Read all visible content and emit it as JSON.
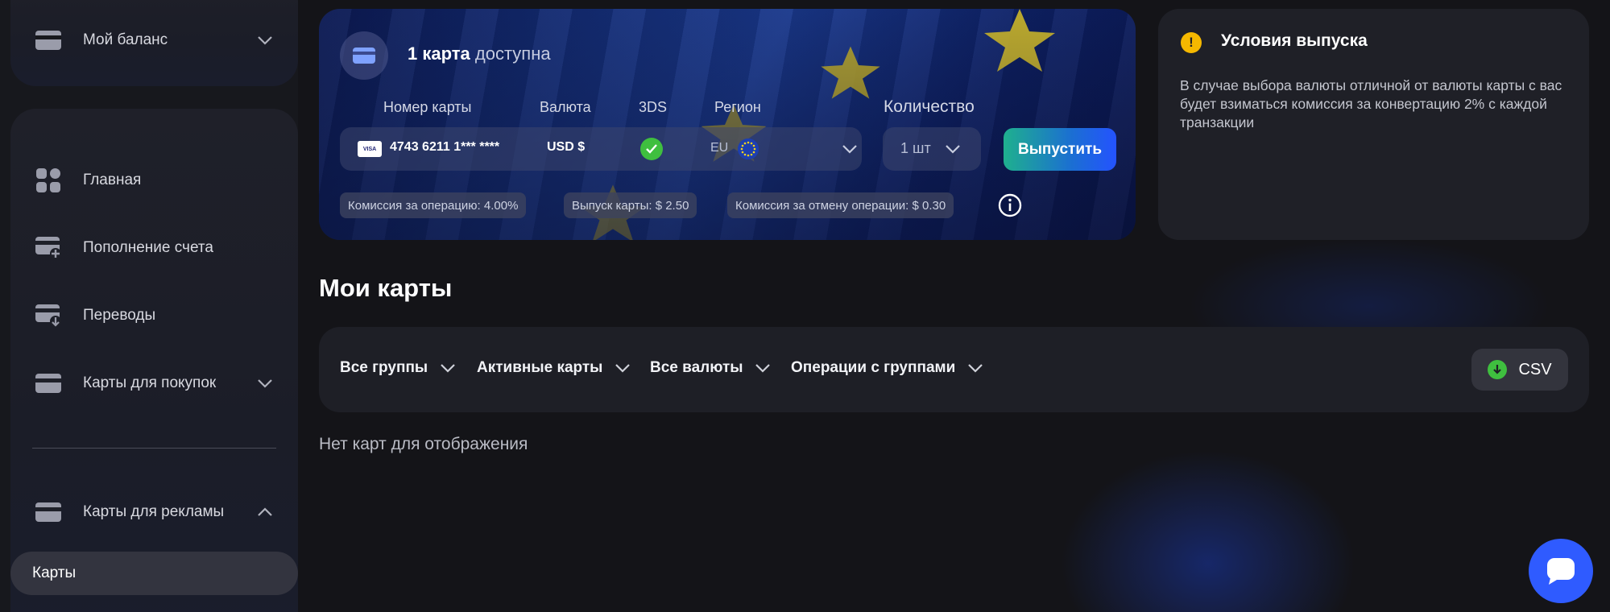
{
  "sidebar": {
    "balance_label": "Мой баланс",
    "items": [
      {
        "label": "Главная",
        "icon": "dashboard-grid-icon"
      },
      {
        "label": "Пополнение счета",
        "icon": "card-add-icon"
      },
      {
        "label": "Переводы",
        "icon": "card-transfer-icon"
      },
      {
        "label": "Карты для покупок",
        "icon": "card-icon"
      },
      {
        "label": "Карты для рекламы",
        "icon": "card-icon"
      }
    ],
    "active_sub_item": "Карты"
  },
  "issue": {
    "available_count": "1 карта",
    "available_text": "доступна",
    "headers": {
      "number": "Номер карты",
      "currency": "Валюта",
      "threeds": "3DS",
      "region": "Регион",
      "quantity": "Количество"
    },
    "card_brand": "VISA",
    "card_number": "4743 6211 1*** ****",
    "currency": "USD $",
    "region": "EU",
    "quantity": "1 шт",
    "button": "Выпустить",
    "fees": {
      "operation": "Комиссия за операцию: 4.00%",
      "issue": "Выпуск карты: $ 2.50",
      "cancel": "Комиссия за отмену операции: $ 0.30"
    }
  },
  "conditions": {
    "title": "Условия выпуска",
    "text": "В случае выбора валюты отличной от валюты карты с вас будет взиматься комиссия за конвертацию 2% с каждой транзакции"
  },
  "my_cards": {
    "title": "Мои карты",
    "filters": [
      "Все группы",
      "Активные карты",
      "Все валюты",
      "Операции с группами"
    ],
    "csv": "CSV",
    "empty": "Нет карт для отображения"
  },
  "colors": {
    "accent_blue": "#2f5bff",
    "success_green": "#3fbf3f",
    "warning_yellow": "#f5b800"
  }
}
